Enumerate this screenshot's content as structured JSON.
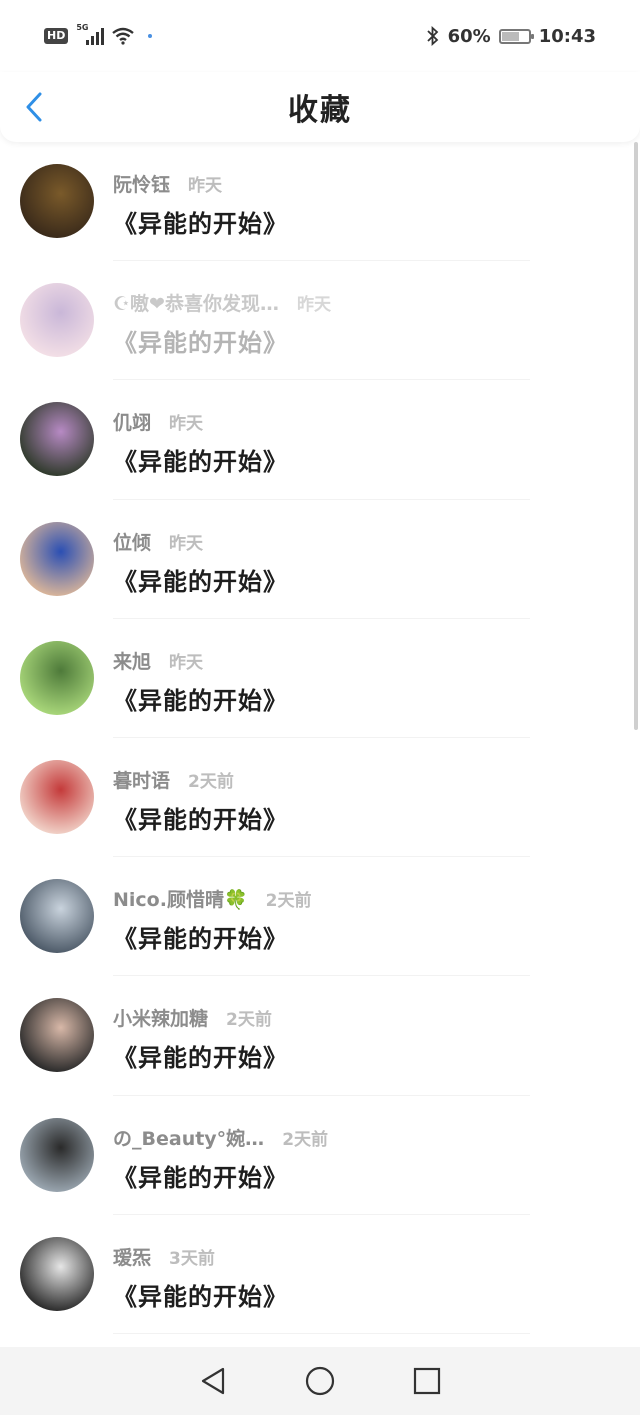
{
  "status_bar": {
    "hd": "HD",
    "network": "5G",
    "battery_pct": "60%",
    "battery_level": 0.6,
    "time": "10:43",
    "icons": [
      "signal-icon",
      "wifi-icon",
      "bluetooth-icon",
      "battery-icon"
    ]
  },
  "header": {
    "title": "收藏",
    "back_icon": "chevron-left-icon",
    "accent": "#2f8fe6"
  },
  "items": [
    {
      "name": "阮怜钰",
      "time": "昨天",
      "title": "《异能的开始》",
      "faded": false,
      "colors": [
        "#3a2a1a",
        "#7a5a2a"
      ]
    },
    {
      "name": "☪嗷❤恭喜你发现…",
      "time": "昨天",
      "title": "《异能的开始》",
      "faded": true,
      "colors": [
        "#f3dfe6",
        "#c9b7d8"
      ]
    },
    {
      "name": "仉翊",
      "time": "昨天",
      "title": "《异能的开始》",
      "faded": false,
      "colors": [
        "#2f3a2b",
        "#b78ac4"
      ]
    },
    {
      "name": "位倾",
      "time": "昨天",
      "title": "《异能的开始》",
      "faded": false,
      "colors": [
        "#d9b59a",
        "#2b4fb3"
      ]
    },
    {
      "name": "来旭",
      "time": "昨天",
      "title": "《异能的开始》",
      "faded": false,
      "colors": [
        "#a9d77a",
        "#4e7a3a"
      ]
    },
    {
      "name": "暮时语",
      "time": "2天前",
      "title": "《异能的开始》",
      "faded": false,
      "colors": [
        "#f1d2c8",
        "#c43a3a"
      ]
    },
    {
      "name": "Nico.顾惜晴🍀",
      "time": "2天前",
      "title": "《异能的开始》",
      "faded": false,
      "colors": [
        "#4d5a68",
        "#c9d3dd"
      ]
    },
    {
      "name": "小米辣加糖",
      "time": "2天前",
      "title": "《异能的开始》",
      "faded": false,
      "colors": [
        "#2a2a2a",
        "#d8b8a8"
      ]
    },
    {
      "name": "の_Beauty°婉…",
      "time": "2天前",
      "title": "《异能的开始》",
      "faded": false,
      "colors": [
        "#9aa6b0",
        "#2a2a2a"
      ]
    },
    {
      "name": "瑷炁",
      "time": "3天前",
      "title": "《异能的开始》",
      "faded": false,
      "colors": [
        "#2b2b2b",
        "#e6e6e6"
      ]
    }
  ],
  "nav": {
    "back_icon": "triangle-back-icon",
    "home_icon": "circle-home-icon",
    "recents_icon": "square-recents-icon"
  }
}
